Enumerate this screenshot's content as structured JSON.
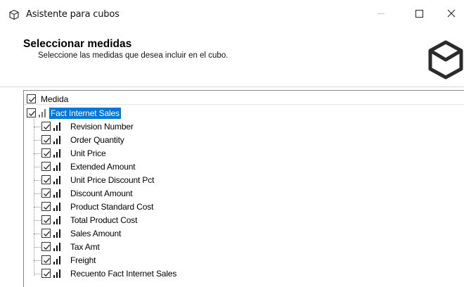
{
  "window": {
    "title": "Asistente para cubos",
    "minimize_icon": "minimize-icon",
    "maximize_icon": "maximize-icon",
    "close_icon": "close-icon",
    "close_glyph": "×"
  },
  "header": {
    "title": "Seleccionar medidas",
    "subtitle": "Seleccione las medidas que desea incluir en el cubo."
  },
  "tree": {
    "column_header": "Medida",
    "column_checked": true,
    "root": {
      "label": "Fact Internet Sales",
      "checked": true,
      "selected": true
    },
    "items": [
      {
        "label": "Revision Number",
        "checked": true
      },
      {
        "label": "Order Quantity",
        "checked": true
      },
      {
        "label": "Unit Price",
        "checked": true
      },
      {
        "label": "Extended Amount",
        "checked": true
      },
      {
        "label": "Unit Price Discount Pct",
        "checked": true
      },
      {
        "label": "Discount Amount",
        "checked": true
      },
      {
        "label": "Product Standard Cost",
        "checked": true
      },
      {
        "label": "Total Product Cost",
        "checked": true
      },
      {
        "label": "Sales Amount",
        "checked": true
      },
      {
        "label": "Tax Amt",
        "checked": true
      },
      {
        "label": "Freight",
        "checked": true
      },
      {
        "label": "Recuento Fact Internet Sales",
        "checked": true
      }
    ]
  },
  "colors": {
    "selection": "#0078d7",
    "border": "#828790"
  }
}
